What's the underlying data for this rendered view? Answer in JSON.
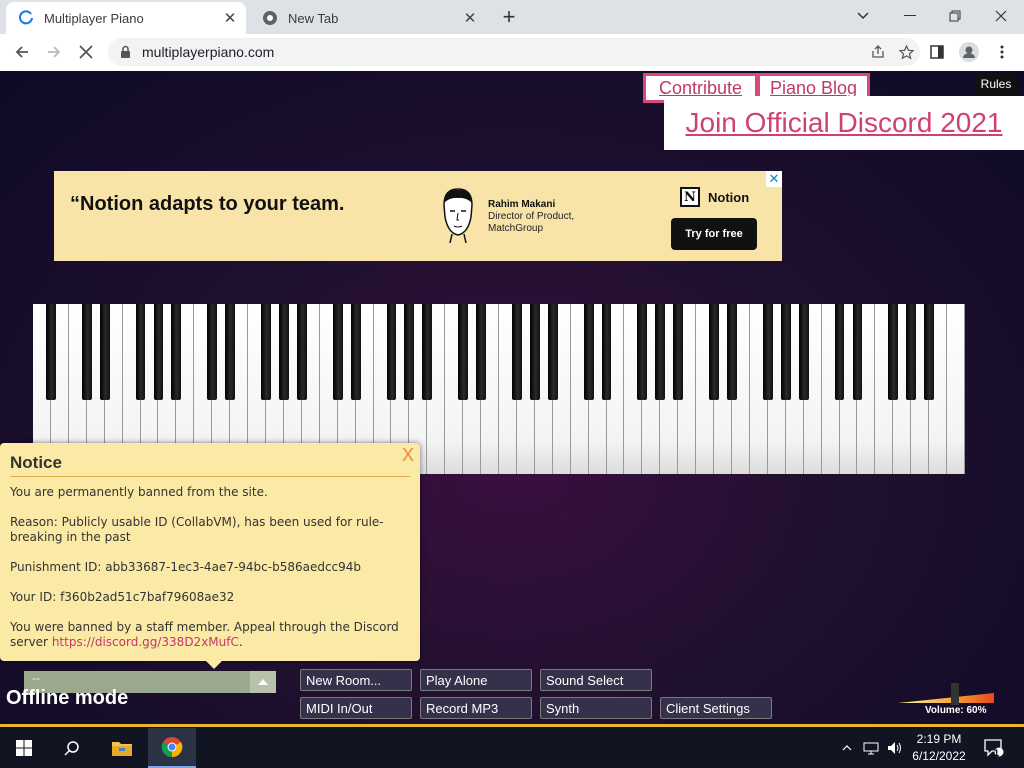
{
  "browser": {
    "tabs": [
      {
        "title": "Multiplayer Piano",
        "active": true
      },
      {
        "title": "New Tab",
        "active": false
      }
    ],
    "url": "multiplayerpiano.com"
  },
  "page": {
    "links": {
      "contribute": "Contribute",
      "piano_blog": "Piano Blog",
      "rules": "Rules",
      "discord": "Join Official Discord 2021"
    },
    "ad": {
      "headline": "“Notion adapts to your team.",
      "person_name": "Rahim Makani",
      "person_role": "Director of Product, MatchGroup",
      "brand": "Notion",
      "cta": "Try for free"
    },
    "notice": {
      "title": "Notice",
      "close": "X",
      "line1": "You are permanently banned from the site.",
      "line2": "Reason: Publicly usable ID (CollabVM), has been used for rule-breaking in the past",
      "line3": "Punishment ID: abb33687-1ec3-4ae7-94bc-b586aedcc94b",
      "line4": "Your ID: f360b2ad51c7baf79608ae32",
      "line5_prefix": "You were banned by a staff member. Appeal through the Discord server",
      "line5_link": "https://discord.gg/338D2xMufC",
      "line5_suffix": "."
    },
    "chat": {
      "value": "--"
    },
    "status": "Offline mode",
    "buttons": {
      "new_room": "New Room...",
      "play_alone": "Play Alone",
      "sound_select": "Sound Select",
      "midi": "MIDI In/Out",
      "record": "Record MP3",
      "synth": "Synth",
      "client_settings": "Client Settings"
    },
    "volume": {
      "label": "Volume: 60%",
      "value": 0.6
    }
  },
  "taskbar": {
    "time": "2:19 PM",
    "date": "6/12/2022",
    "notifications": "1"
  }
}
